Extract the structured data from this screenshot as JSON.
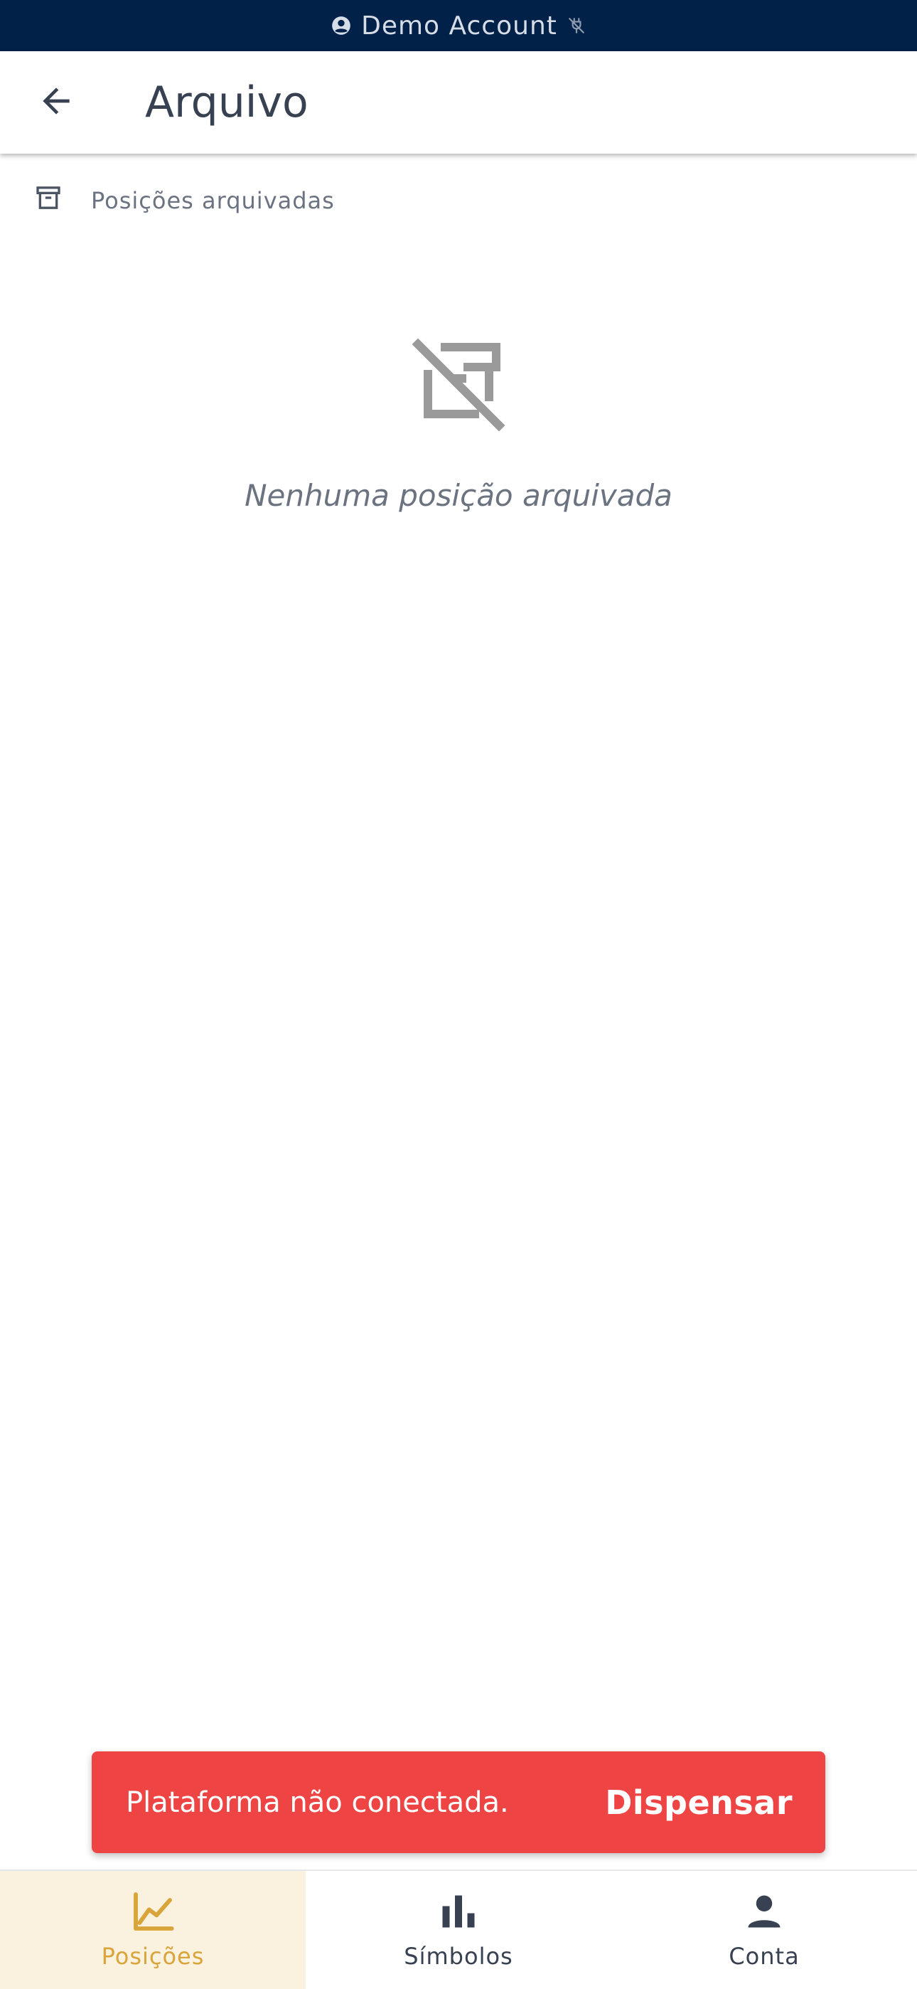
{
  "banner": {
    "account_label": "Demo Account",
    "icons": [
      "account-circle-icon",
      "disconnected-plug-icon"
    ]
  },
  "appbar": {
    "title": "Arquivo",
    "back_icon": "arrow-back-icon"
  },
  "section": {
    "label": "Posições arquivadas",
    "icon": "archive-icon"
  },
  "empty_state": {
    "icon": "archive-off-icon",
    "message": "Nenhuma posição arquivada"
  },
  "snackbar": {
    "message": "Plataforma não conectada.",
    "action_label": "Dispensar"
  },
  "bottom_nav": {
    "items": [
      {
        "label": "Posições",
        "icon": "line-chart-icon",
        "active": true
      },
      {
        "label": "Símbolos",
        "icon": "bar-chart-icon",
        "active": false
      },
      {
        "label": "Conta",
        "icon": "person-icon",
        "active": false
      }
    ]
  },
  "colors": {
    "banner_bg": "#012148",
    "accent": "#d9a43a",
    "accent_bg": "#fbf1df",
    "snackbar_bg": "#ef4444",
    "text_dark": "#374151",
    "text_muted": "#6b7280"
  }
}
